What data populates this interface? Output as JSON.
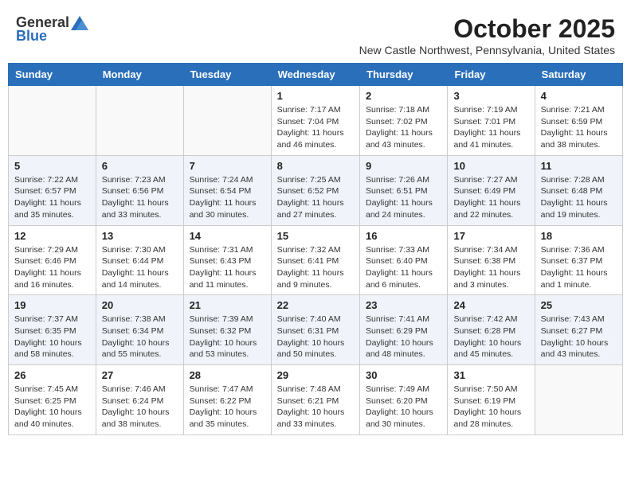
{
  "header": {
    "logo_general": "General",
    "logo_blue": "Blue",
    "month_title": "October 2025",
    "location": "New Castle Northwest, Pennsylvania, United States"
  },
  "days_of_week": [
    "Sunday",
    "Monday",
    "Tuesday",
    "Wednesday",
    "Thursday",
    "Friday",
    "Saturday"
  ],
  "weeks": [
    [
      {
        "day": "",
        "info": ""
      },
      {
        "day": "",
        "info": ""
      },
      {
        "day": "",
        "info": ""
      },
      {
        "day": "1",
        "info": "Sunrise: 7:17 AM\nSunset: 7:04 PM\nDaylight: 11 hours\nand 46 minutes."
      },
      {
        "day": "2",
        "info": "Sunrise: 7:18 AM\nSunset: 7:02 PM\nDaylight: 11 hours\nand 43 minutes."
      },
      {
        "day": "3",
        "info": "Sunrise: 7:19 AM\nSunset: 7:01 PM\nDaylight: 11 hours\nand 41 minutes."
      },
      {
        "day": "4",
        "info": "Sunrise: 7:21 AM\nSunset: 6:59 PM\nDaylight: 11 hours\nand 38 minutes."
      }
    ],
    [
      {
        "day": "5",
        "info": "Sunrise: 7:22 AM\nSunset: 6:57 PM\nDaylight: 11 hours\nand 35 minutes."
      },
      {
        "day": "6",
        "info": "Sunrise: 7:23 AM\nSunset: 6:56 PM\nDaylight: 11 hours\nand 33 minutes."
      },
      {
        "day": "7",
        "info": "Sunrise: 7:24 AM\nSunset: 6:54 PM\nDaylight: 11 hours\nand 30 minutes."
      },
      {
        "day": "8",
        "info": "Sunrise: 7:25 AM\nSunset: 6:52 PM\nDaylight: 11 hours\nand 27 minutes."
      },
      {
        "day": "9",
        "info": "Sunrise: 7:26 AM\nSunset: 6:51 PM\nDaylight: 11 hours\nand 24 minutes."
      },
      {
        "day": "10",
        "info": "Sunrise: 7:27 AM\nSunset: 6:49 PM\nDaylight: 11 hours\nand 22 minutes."
      },
      {
        "day": "11",
        "info": "Sunrise: 7:28 AM\nSunset: 6:48 PM\nDaylight: 11 hours\nand 19 minutes."
      }
    ],
    [
      {
        "day": "12",
        "info": "Sunrise: 7:29 AM\nSunset: 6:46 PM\nDaylight: 11 hours\nand 16 minutes."
      },
      {
        "day": "13",
        "info": "Sunrise: 7:30 AM\nSunset: 6:44 PM\nDaylight: 11 hours\nand 14 minutes."
      },
      {
        "day": "14",
        "info": "Sunrise: 7:31 AM\nSunset: 6:43 PM\nDaylight: 11 hours\nand 11 minutes."
      },
      {
        "day": "15",
        "info": "Sunrise: 7:32 AM\nSunset: 6:41 PM\nDaylight: 11 hours\nand 9 minutes."
      },
      {
        "day": "16",
        "info": "Sunrise: 7:33 AM\nSunset: 6:40 PM\nDaylight: 11 hours\nand 6 minutes."
      },
      {
        "day": "17",
        "info": "Sunrise: 7:34 AM\nSunset: 6:38 PM\nDaylight: 11 hours\nand 3 minutes."
      },
      {
        "day": "18",
        "info": "Sunrise: 7:36 AM\nSunset: 6:37 PM\nDaylight: 11 hours\nand 1 minute."
      }
    ],
    [
      {
        "day": "19",
        "info": "Sunrise: 7:37 AM\nSunset: 6:35 PM\nDaylight: 10 hours\nand 58 minutes."
      },
      {
        "day": "20",
        "info": "Sunrise: 7:38 AM\nSunset: 6:34 PM\nDaylight: 10 hours\nand 55 minutes."
      },
      {
        "day": "21",
        "info": "Sunrise: 7:39 AM\nSunset: 6:32 PM\nDaylight: 10 hours\nand 53 minutes."
      },
      {
        "day": "22",
        "info": "Sunrise: 7:40 AM\nSunset: 6:31 PM\nDaylight: 10 hours\nand 50 minutes."
      },
      {
        "day": "23",
        "info": "Sunrise: 7:41 AM\nSunset: 6:29 PM\nDaylight: 10 hours\nand 48 minutes."
      },
      {
        "day": "24",
        "info": "Sunrise: 7:42 AM\nSunset: 6:28 PM\nDaylight: 10 hours\nand 45 minutes."
      },
      {
        "day": "25",
        "info": "Sunrise: 7:43 AM\nSunset: 6:27 PM\nDaylight: 10 hours\nand 43 minutes."
      }
    ],
    [
      {
        "day": "26",
        "info": "Sunrise: 7:45 AM\nSunset: 6:25 PM\nDaylight: 10 hours\nand 40 minutes."
      },
      {
        "day": "27",
        "info": "Sunrise: 7:46 AM\nSunset: 6:24 PM\nDaylight: 10 hours\nand 38 minutes."
      },
      {
        "day": "28",
        "info": "Sunrise: 7:47 AM\nSunset: 6:22 PM\nDaylight: 10 hours\nand 35 minutes."
      },
      {
        "day": "29",
        "info": "Sunrise: 7:48 AM\nSunset: 6:21 PM\nDaylight: 10 hours\nand 33 minutes."
      },
      {
        "day": "30",
        "info": "Sunrise: 7:49 AM\nSunset: 6:20 PM\nDaylight: 10 hours\nand 30 minutes."
      },
      {
        "day": "31",
        "info": "Sunrise: 7:50 AM\nSunset: 6:19 PM\nDaylight: 10 hours\nand 28 minutes."
      },
      {
        "day": "",
        "info": ""
      }
    ]
  ]
}
